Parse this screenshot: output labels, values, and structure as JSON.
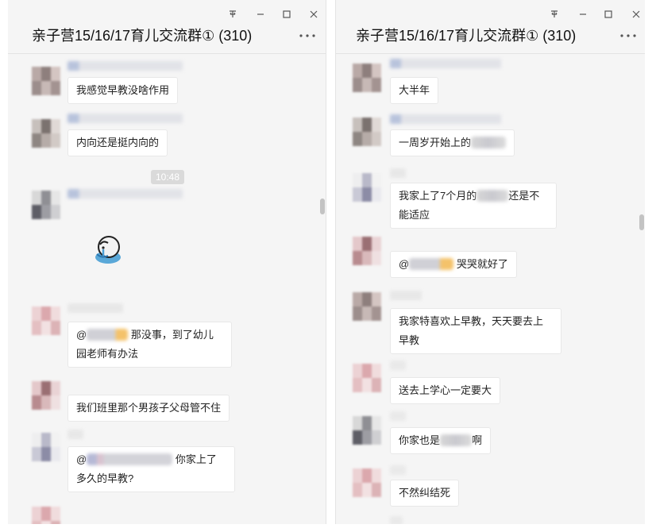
{
  "left_window": {
    "title": "亲子营15/16/17育儿交流群① (310)",
    "icons": {
      "pin": "pin-icon",
      "minimize": "minimize-icon",
      "maximize": "maximize-icon",
      "close": "close-icon",
      "more": "more-icon"
    },
    "timestamp": "10:48",
    "messages": [
      {
        "text": "我感觉早教没啥作用"
      },
      {
        "text": "内向还是挺内向的"
      },
      {
        "sticker": "crying-cartoon-sticker"
      },
      {
        "prefix": "@",
        "text": "那没事，到了幼儿园老师有办法"
      },
      {
        "text": "我们班里那个男孩子父母管不住"
      },
      {
        "prefix": "@",
        "text": "你家上了多久的早教?"
      }
    ]
  },
  "right_window": {
    "title": "亲子营15/16/17育儿交流群① (310)",
    "icons": {
      "pin": "pin-icon",
      "minimize": "minimize-icon",
      "maximize": "maximize-icon",
      "close": "close-icon",
      "more": "more-icon"
    },
    "messages": [
      {
        "text": "大半年"
      },
      {
        "text": "一周岁开始上的"
      },
      {
        "before": "我家上了7个月的",
        "after": "还是不能适应"
      },
      {
        "prefix": "@",
        "text": "哭哭就好了"
      },
      {
        "text": "我家特喜欢上早教，天天要去上早教"
      },
      {
        "text": "送去上学心一定要大"
      },
      {
        "before": "你家也是",
        "after": "啊"
      },
      {
        "text": "不然纠结死"
      }
    ]
  }
}
